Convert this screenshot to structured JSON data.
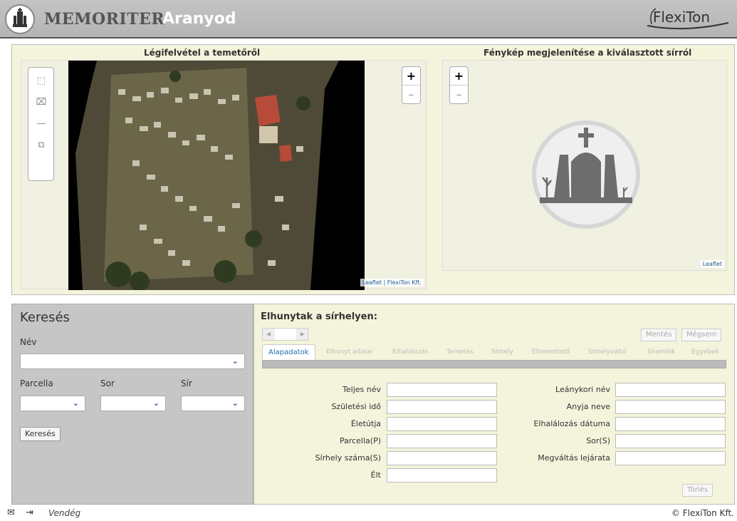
{
  "header": {
    "brand": "MEMORITER",
    "town": "Aranyod",
    "company_logo": "FlexiTon"
  },
  "map_panel": {
    "aerial_title": "Légifelvétel a temetőről",
    "photo_title": "Fénykép megjelenítése a kiválasztott sírról",
    "zoom_in": "+",
    "zoom_out": "–",
    "aerial_attribution": "Leaflet | FlexiTon Kft.",
    "photo_attribution": "Leaflet"
  },
  "search": {
    "title": "Keresés",
    "name_label": "Név",
    "parcel_label": "Parcella",
    "row_label": "Sor",
    "grave_label": "Sír",
    "search_button": "Keresés"
  },
  "details": {
    "title": "Elhunytak a sírhelyen:",
    "save_button": "Mentés",
    "cancel_button": "Mégsem",
    "delete_button": "Törlés",
    "tabs": [
      {
        "label": "Alapadatok",
        "active": true
      },
      {
        "label": "Elhunyt adatai",
        "active": false
      },
      {
        "label": "Elhalálozás",
        "active": false
      },
      {
        "label": "Temetés",
        "active": false
      },
      {
        "label": "Sírhely",
        "active": false
      },
      {
        "label": "Eltemettető",
        "active": false
      },
      {
        "label": "Sírhelyváltó",
        "active": false
      },
      {
        "label": "Síremlék",
        "active": false
      },
      {
        "label": "Egyebek",
        "active": false
      }
    ],
    "fields_left": [
      {
        "label": "Teljes név"
      },
      {
        "label": "Születési idő"
      },
      {
        "label": "Életútja"
      },
      {
        "label": "Parcella(P)"
      },
      {
        "label": "Sírhely száma(S)"
      },
      {
        "label": "Élt"
      }
    ],
    "fields_right": [
      {
        "label": "Leánykori név"
      },
      {
        "label": "Anyja neve"
      },
      {
        "label": "Elhalálozás dátuma"
      },
      {
        "label": "Sor(S)"
      },
      {
        "label": "Megváltás lejárata"
      }
    ]
  },
  "footer": {
    "user": "Vendég",
    "copyright": "© FlexiTon Kft."
  }
}
